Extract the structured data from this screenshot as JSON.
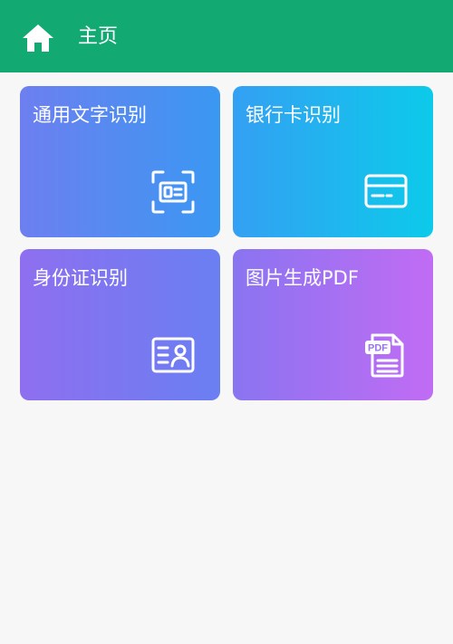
{
  "app_bar": {
    "title": "主页",
    "background": "#12aa72",
    "home_icon": "home-icon"
  },
  "cards": [
    {
      "label": "通用文字识别",
      "icon": "scan-text-icon"
    },
    {
      "label": "银行卡识别",
      "icon": "bank-card-icon"
    },
    {
      "label": "身份证识别",
      "icon": "id-card-icon"
    },
    {
      "label": "图片生成PDF",
      "icon": "pdf-file-icon"
    }
  ]
}
